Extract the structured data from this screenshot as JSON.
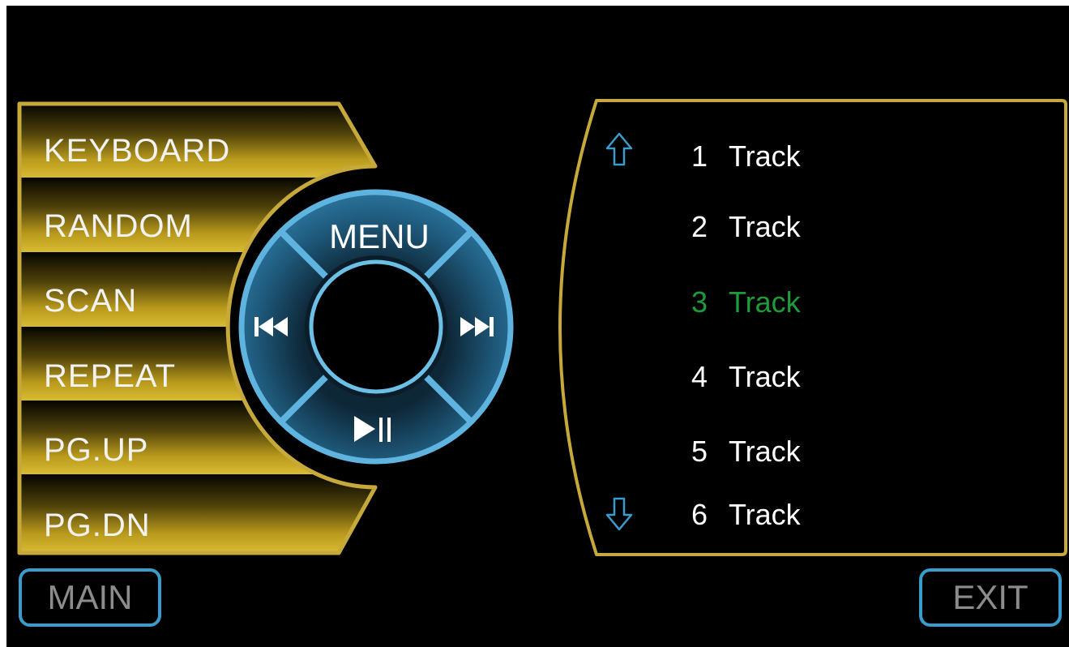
{
  "colors": {
    "gold": "#c7a93b",
    "gold_dark": "#4a3d05",
    "wheel_blue": "#2d7aa3",
    "wheel_edge": "#5fb4df",
    "bottom_button_border": "#3a9ccc",
    "active_track": "#1e9b3a",
    "track_text": "#ffffff"
  },
  "side_menu": {
    "items": [
      {
        "label": "KEYBOARD"
      },
      {
        "label": "RANDOM"
      },
      {
        "label": "SCAN"
      },
      {
        "label": "REPEAT"
      },
      {
        "label": "PG.UP"
      },
      {
        "label": "PG.DN"
      }
    ]
  },
  "control_wheel": {
    "top_label": "MENU",
    "left_icon": "previous-track-icon",
    "right_icon": "next-track-icon",
    "bottom_icon": "play-pause-icon"
  },
  "playlist": {
    "scroll_up_icon": "arrow-up-icon",
    "scroll_down_icon": "arrow-down-icon",
    "active_index": 2,
    "tracks": [
      {
        "number": "1",
        "title": "Track"
      },
      {
        "number": "2",
        "title": "Track"
      },
      {
        "number": "3",
        "title": "Track"
      },
      {
        "number": "4",
        "title": "Track"
      },
      {
        "number": "5",
        "title": "Track"
      },
      {
        "number": "6",
        "title": "Track"
      }
    ]
  },
  "footer": {
    "main_label": "MAIN",
    "exit_label": "EXIT"
  }
}
